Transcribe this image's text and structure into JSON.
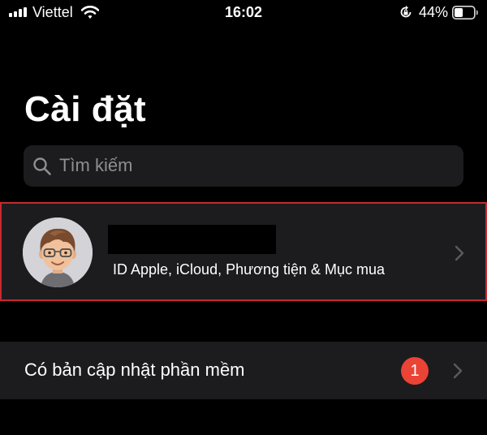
{
  "status_bar": {
    "carrier": "Viettel",
    "time": "16:02",
    "battery_percent": "44%",
    "icons": [
      "signal-icon",
      "wifi-icon",
      "rotation-lock-icon",
      "battery-icon"
    ],
    "battery_level": 0.44
  },
  "title": "Cài đặt",
  "search": {
    "placeholder": "Tìm kiếm"
  },
  "account": {
    "name": "",
    "subtitle": "ID Apple, iCloud, Phương tiện & Mục mua",
    "avatar": "memoji-avatar"
  },
  "software_update": {
    "label": "Có bản cập nhật phần mềm",
    "badge": "1"
  },
  "colors": {
    "background": "#000000",
    "cell_background": "#1c1c1e",
    "highlight_border": "#c8282e",
    "badge": "#eb4336",
    "secondary_text": "#8e8e93"
  }
}
